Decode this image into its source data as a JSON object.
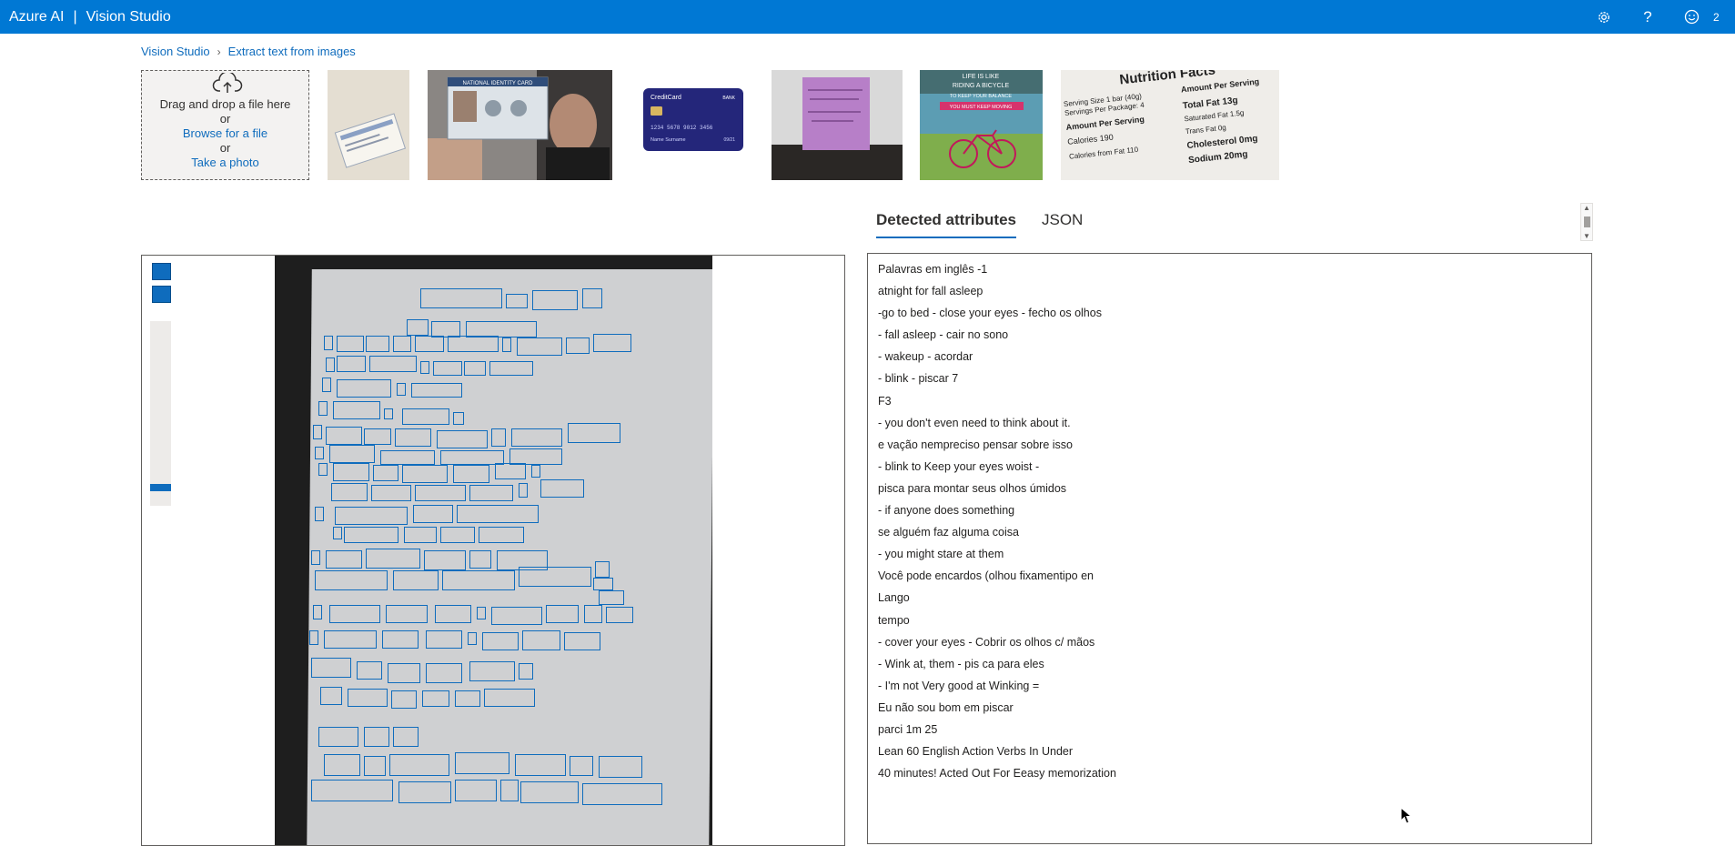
{
  "app": {
    "brand": "Azure AI",
    "separator": "|",
    "title": "Vision Studio",
    "user_initial": "2",
    "icons": [
      "gear-icon",
      "help-icon",
      "feedback-smiley-icon"
    ]
  },
  "breadcrumb": {
    "root": "Vision Studio",
    "current": "Extract text from images"
  },
  "upload": {
    "line1": "Drag and drop a file here",
    "line2": "or",
    "browse": "Browse for a file",
    "line4": "or",
    "photo": "Take a photo"
  },
  "thumbnails": {
    "id_card_title": "NATIONAL IDENTITY CARD",
    "credit_card_title": "CreditCard",
    "credit_card_bank": "BANK",
    "credit_card_number": "1234 5678 9012 3456",
    "credit_card_name": "Name Surname",
    "credit_card_date": "09/21",
    "poster_top": "LIFE IS LIKE",
    "poster_mid": "RIDING A BICYCLE",
    "poster_sub": "TO KEEP YOUR BALANCE",
    "poster_bottom": "YOU MUST KEEP MOVING",
    "nutrition_title": "Nutrition Facts",
    "nutrition_lines": [
      "Serving Size 1 bar (40g)",
      "Servings Per Package: 4",
      "Amount Per Serving",
      "Calories 190",
      "Calories from Fat 110",
      "Amount Per Serving",
      "Total Fat 13g",
      "Saturated Fat 1.5g",
      "Trans Fat 0g",
      "Cholesterol 0mg",
      "Sodium 20mg"
    ]
  },
  "tabs": {
    "detected": "Detected attributes",
    "json": "JSON",
    "active": "Detected attributes"
  },
  "results": {
    "lines": [
      "Palavras em inglês -1",
      "atnight for fall asleep",
      "-go to bed - close your eyes - fecho os olhos",
      "- fall asleep - cair no sono",
      "- wakeup - acordar",
      "- blink - piscar 7",
      "F3",
      "- you don't even need to think about it.",
      "e vação nempreciso pensar sobre isso",
      "- blink to Keep your eyes woist -",
      "pisca para montar seus olhos úmidos",
      "- if anyone does something",
      "se alguém faz alguma coisa",
      "- you might stare at them",
      "Você pode encardos (olhou fixamentipo en",
      "Lango",
      "tempo",
      "- cover your eyes - Cobrir os olhos c/ mãos",
      "- Wink at, them - pis ca para eles",
      "- I'm not Very good at Winking =",
      "Eu não sou bom em piscar",
      "parci 1m 25",
      "Lean 60 English Action Verbs In Under",
      "40 minutes! Acted Out For Eeasy memorization"
    ]
  },
  "colors": {
    "topbar": "#0078d4",
    "accent": "#0f6cbd",
    "box": "#0f6cbd"
  }
}
